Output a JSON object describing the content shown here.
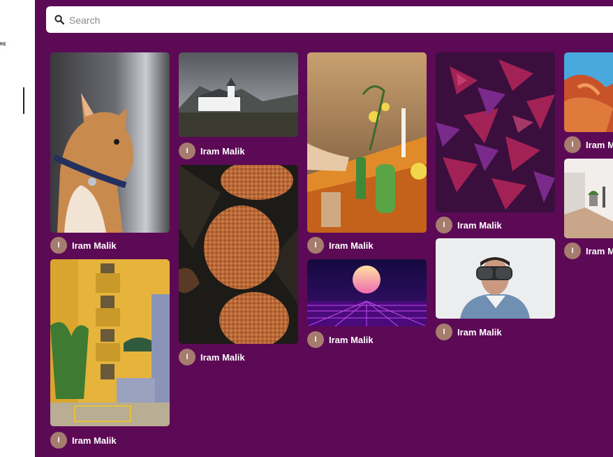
{
  "sidebar": {
    "fragment_text": "RE"
  },
  "search": {
    "placeholder": "Search",
    "icon": "search-icon"
  },
  "colors": {
    "main_background": "#5c0a56",
    "avatar_background": "#a67c6e",
    "author_text": "#ffffff"
  },
  "photos": [
    {
      "subject": "cat",
      "author_initial": "I",
      "author_name": "Iram Malik"
    },
    {
      "subject": "building",
      "author_initial": "I",
      "author_name": "Iram Malik"
    },
    {
      "subject": "church",
      "author_initial": "I",
      "author_name": "Iram Malik"
    },
    {
      "subject": "pinecones",
      "author_initial": "I",
      "author_name": "Iram Malik"
    },
    {
      "subject": "candles",
      "author_initial": "I",
      "author_name": "Iram Malik"
    },
    {
      "subject": "synthwave-sun",
      "author_initial": "I",
      "author_name": "Iram Malik"
    },
    {
      "subject": "purple-leaves",
      "author_initial": "I",
      "author_name": "Iram Malik"
    },
    {
      "subject": "vr-headset",
      "author_initial": "I",
      "author_name": "Iram Malik"
    },
    {
      "subject": "red-rock",
      "author_initial": "I",
      "author_name": "Iram Malik"
    },
    {
      "subject": "interior",
      "author_initial": "I",
      "author_name": "Iram Malik"
    }
  ]
}
